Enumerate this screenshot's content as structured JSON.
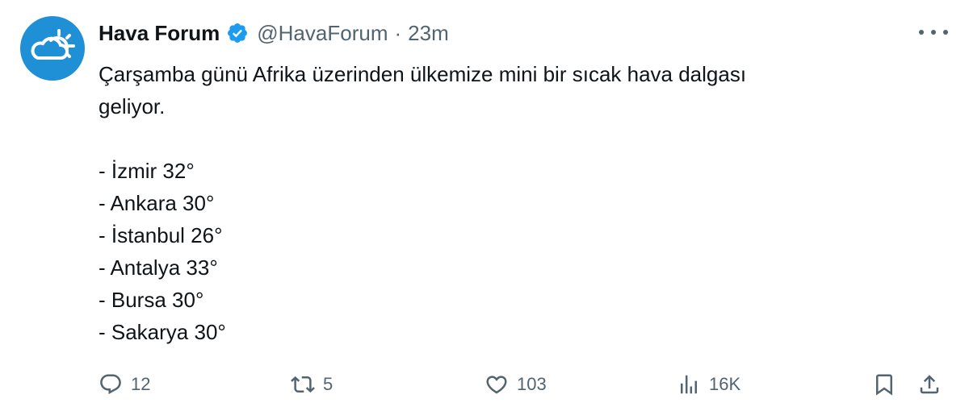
{
  "tweet": {
    "author": {
      "name": "Hava Forum",
      "handle": "@HavaForum",
      "separator": "·",
      "time": "23m",
      "verified": true,
      "avatar_color": "#1f8fd6",
      "verified_color": "#1d9bf0"
    },
    "text": {
      "line1": "Çarşamba günü Afrika üzerinden ülkemize mini bir sıcak hava dalgası",
      "line2": "geliyor.",
      "cities": [
        "- İzmir 32°",
        "- Ankara 30°",
        "- İstanbul 26°",
        "- Antalya 33°",
        "- Bursa 30°",
        "- Sakarya 30°"
      ]
    },
    "actions": {
      "replies": "12",
      "retweets": "5",
      "likes": "103",
      "views": "16K",
      "icons": [
        "reply-icon",
        "retweet-icon",
        "like-icon",
        "views-icon",
        "bookmark-icon",
        "share-icon"
      ]
    },
    "more_icon": "more-icon"
  }
}
